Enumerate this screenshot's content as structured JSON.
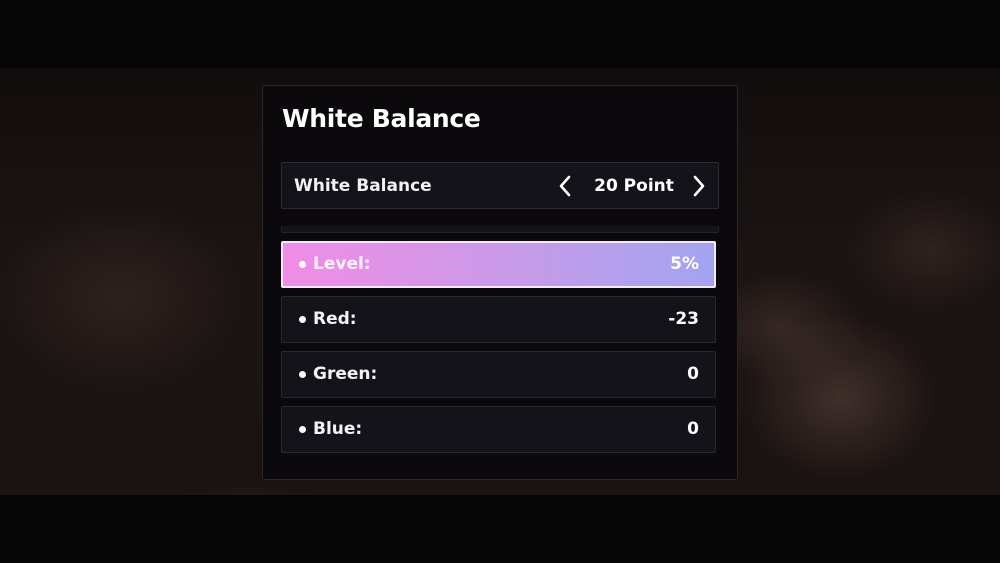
{
  "panel": {
    "title": "White Balance"
  },
  "selector": {
    "label": "White Balance",
    "value": "20 Point",
    "icons": {
      "previous": "chevron-left-icon",
      "next": "chevron-right-icon"
    }
  },
  "items": [
    {
      "bullet": "•",
      "label": "Level:",
      "value": "5%",
      "selected": true
    },
    {
      "bullet": "•",
      "label": "Red:",
      "value": "-23",
      "selected": false
    },
    {
      "bullet": "•",
      "label": "Green:",
      "value": "0",
      "selected": false
    },
    {
      "bullet": "•",
      "label": "Blue:",
      "value": "0",
      "selected": false
    }
  ],
  "colors": {
    "selected_gradient_start": "#f08ce6",
    "selected_gradient_end": "#a2a4f0",
    "panel_background": "#0b090c",
    "row_background": "#15131a",
    "text": "#ffffff"
  }
}
